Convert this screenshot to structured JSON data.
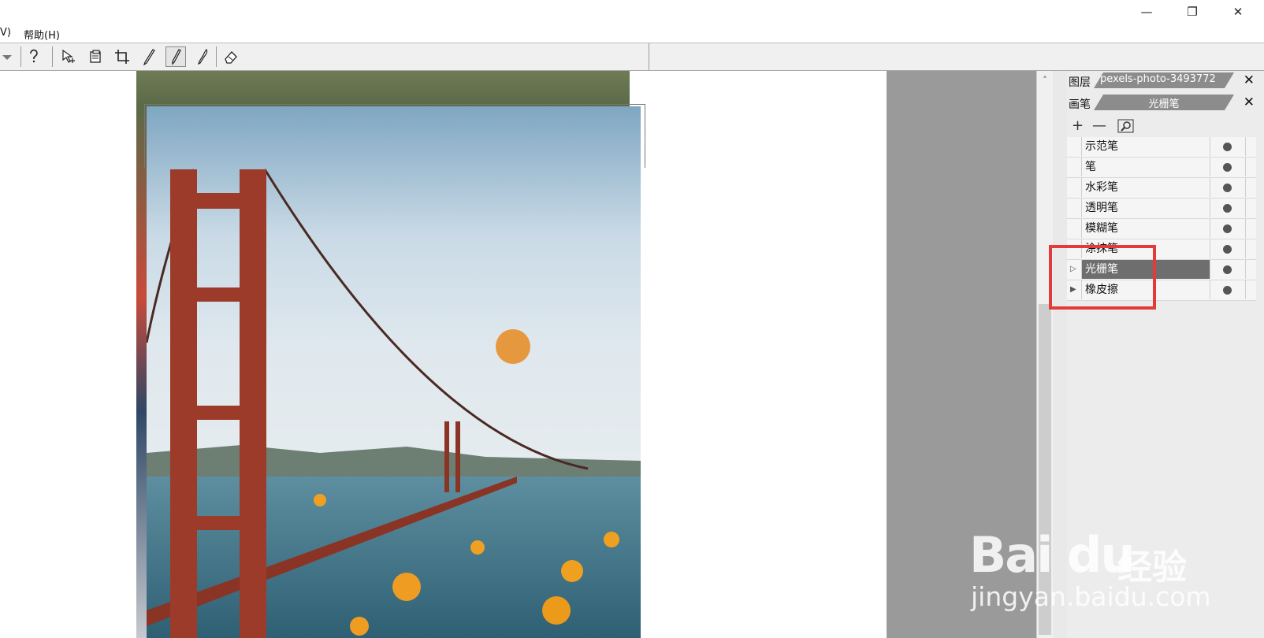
{
  "window": {
    "minimize_icon": "minimize-icon",
    "restore_icon": "restore-icon",
    "close_icon": "close-icon"
  },
  "menubar": {
    "items": [
      "V)",
      "帮助(H)"
    ]
  },
  "toolbar": {
    "icons": [
      "dropdown-arrow-icon",
      "help-icon",
      "move-select-icon",
      "layer-icon",
      "crop-icon",
      "pen-icon",
      "pencil-icon",
      "brush-icon",
      "eraser-icon"
    ]
  },
  "panel": {
    "layers_tab": {
      "label": "图层",
      "document_name": "pexels-photo-3493772"
    },
    "brush_tab": {
      "label": "画笔",
      "current_brush": "光栅笔"
    },
    "tools": {
      "add": "+",
      "remove": "—",
      "search_icon": "search-icon"
    },
    "brushes": [
      {
        "name": "示范笔",
        "arrow": ""
      },
      {
        "name": "笔",
        "arrow": ""
      },
      {
        "name": "水彩笔",
        "arrow": ""
      },
      {
        "name": "透明笔",
        "arrow": ""
      },
      {
        "name": "模糊笔",
        "arrow": ""
      },
      {
        "name": "涂抹笔",
        "arrow": ""
      },
      {
        "name": "光栅笔",
        "arrow": "▷",
        "selected": true
      },
      {
        "name": "橡皮擦",
        "arrow": "▶"
      }
    ]
  },
  "watermark": {
    "logo": "Bai du",
    "cn": "经验",
    "url": "jingyan.baidu.com"
  },
  "colors": {
    "highlight": "#e33a3a",
    "selected_row": "#6e6e6e",
    "workspace_gray": "#9a9a9a"
  }
}
